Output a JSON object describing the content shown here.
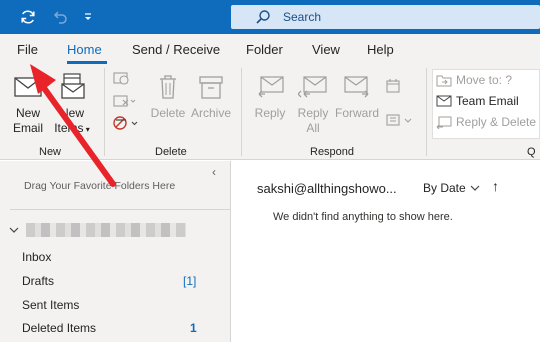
{
  "titlebar": {
    "search_placeholder": "Search",
    "icons": [
      "sync-icon",
      "undo-icon",
      "quick-access-dropdown-icon",
      "search-icon"
    ]
  },
  "tabs": [
    {
      "label": "File"
    },
    {
      "label": "Home",
      "active": true
    },
    {
      "label": "Send / Receive"
    },
    {
      "label": "Folder"
    },
    {
      "label": "View"
    },
    {
      "label": "Help"
    }
  ],
  "ribbon": {
    "new_group": {
      "label": "New",
      "new_email": {
        "line1": "New",
        "line2": "Email"
      },
      "new_items": {
        "line1": "New",
        "line2": "Items"
      }
    },
    "delete_group": {
      "label": "Delete",
      "delete": "Delete",
      "archive": "Archive"
    },
    "respond_group": {
      "label": "Respond",
      "reply": "Reply",
      "reply_all": {
        "line1": "Reply",
        "line2": "All"
      },
      "forward": "Forward"
    },
    "quick_steps_group": {
      "label": "Q",
      "move_to": "Move to: ?",
      "team_email": "Team Email",
      "reply_delete": "Reply & Delete"
    }
  },
  "folder_pane": {
    "drag_hint": "Drag Your Favorite Folders Here",
    "folders": [
      {
        "name": "Inbox",
        "count": ""
      },
      {
        "name": "Drafts",
        "count": "[1]"
      },
      {
        "name": "Sent Items",
        "count": ""
      },
      {
        "name": "Deleted Items",
        "count": "1"
      }
    ]
  },
  "message_list": {
    "mailbox": "sakshi@allthingshowo...",
    "sort_label": "By Date",
    "sort_direction": "↑",
    "empty_text": "We didn't find anything to show here."
  },
  "colors": {
    "accent": "#0f6cbd",
    "annotation_arrow": "#e8232a"
  }
}
